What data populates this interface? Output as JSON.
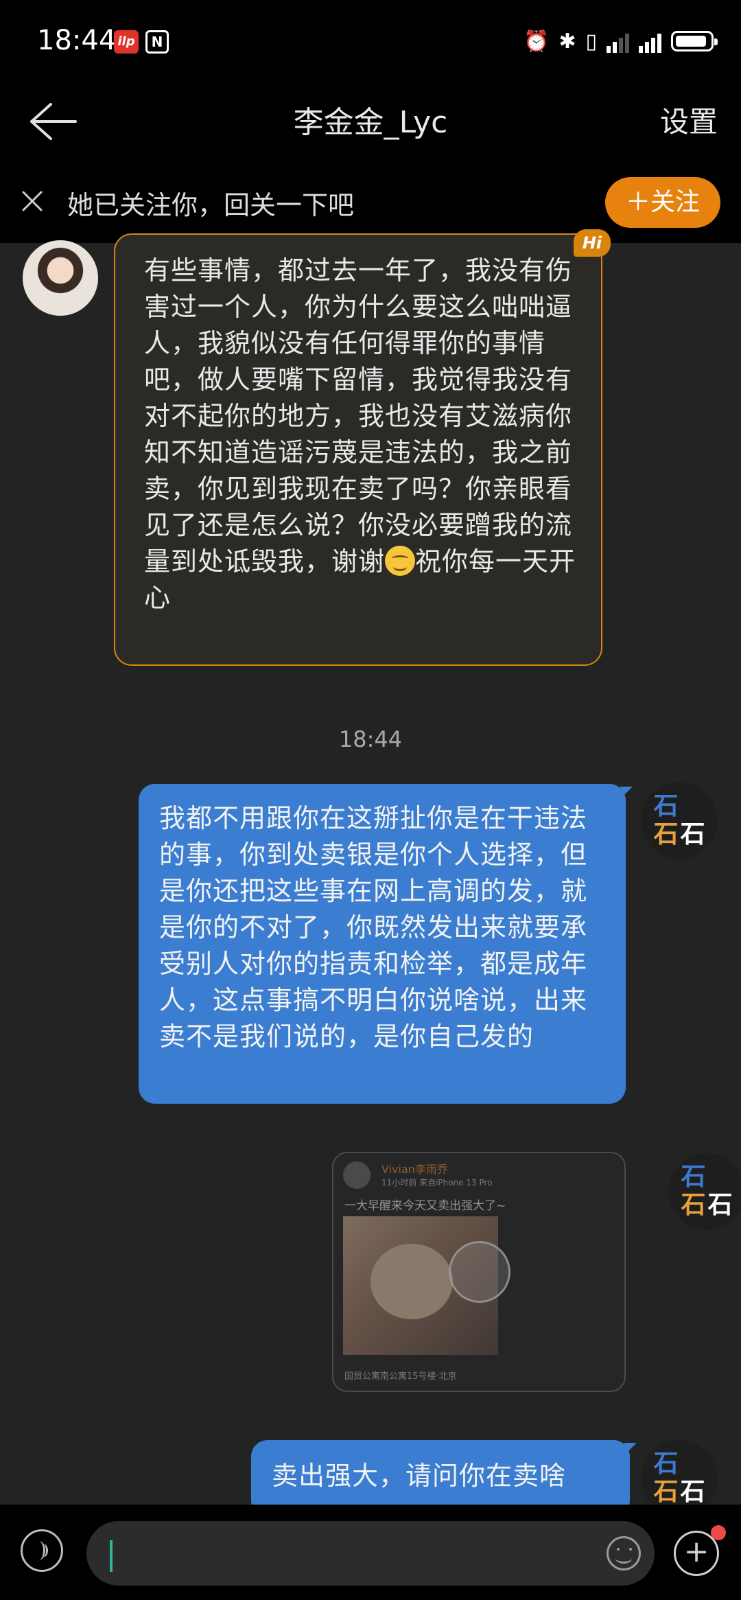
{
  "status_bar": {
    "time": "18:44"
  },
  "header": {
    "title": "李金金_Lyc",
    "settings_label": "设置"
  },
  "follow_banner": {
    "text": "她已关注你，回关一下吧",
    "button_label": "＋关注"
  },
  "messages": [
    {
      "side": "incoming",
      "badge": "Hi",
      "text": "有些事情，都过去一年了，我没有伤害过一个人，你为什么要这么咄咄逼人，我貌似没有任何得罪你的事情吧，做人要嘴下留情，我觉得我没有对不起你的地方，我也没有艾滋病你知不知道造谣污蔑是违法的，我之前卖，你见到我现在卖了吗？你亲眼看见了还是怎么说？你没必要蹭我的流量到处诋毁我，谢谢",
      "text_tail": "祝你每一天开心"
    },
    {
      "side": "timestamp",
      "text": "18:44"
    },
    {
      "side": "outgoing",
      "text": "我都不用跟你在这掰扯你是在干违法的事，你到处卖银是你个人选择，但是你还把这些事在网上高调的发，就是你的不对了，你既然发出来就要承受别人对你的指责和检举，都是成年人，这点事搞不明白你说啥说，出来卖不是我们说的，是你自己发的"
    },
    {
      "side": "outgoing-share",
      "author": "Vivian李雨乔",
      "meta": "11小时前 来自iPhone 13 Pro",
      "caption": "一大早醒来今天又卖出强大了~",
      "location": "国贸公寓南公寓15号楼·北京"
    },
    {
      "side": "outgoing",
      "text": "卖出强大，请问你在卖啥"
    }
  ],
  "right_avatar": {
    "chars": [
      "石",
      "石",
      "石",
      "石"
    ]
  },
  "input_bar": {
    "placeholder": ""
  }
}
